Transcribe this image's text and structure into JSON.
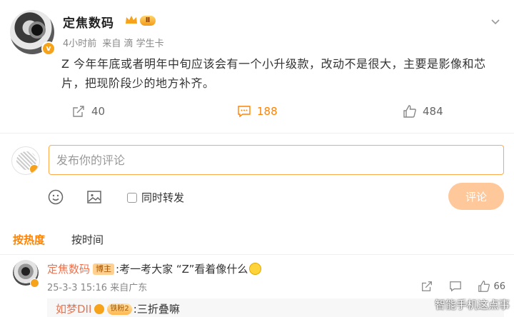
{
  "post": {
    "username": "定焦数码",
    "level": "Ⅱ",
    "time": "4小时前",
    "source_prefix": "来自",
    "source": "滴 学生卡",
    "text": "Z 今年年底或者明年中旬应该会有一个小升级款，改动不是很大，主要是影像和芯片，把现阶段少的地方补齐。",
    "reposts": "40",
    "comments": "188",
    "likes": "484"
  },
  "composer": {
    "placeholder": "发布你的评论",
    "repost_label": "同时转发",
    "submit_label": "评论"
  },
  "sort": {
    "hot_label": "按热度",
    "time_label": "按时间"
  },
  "comment": {
    "username": "定焦数码",
    "author_tag": "博主",
    "text": ":考一考大家 “Z”看着像什么",
    "date": "25-3-3 15:16",
    "location": "来自广东",
    "likes": "66"
  },
  "reply": {
    "username": "如梦DII",
    "fan_badge": "铁粉2",
    "text": ":三折叠嘛"
  },
  "watermark": "智能手机这点事",
  "colors": {
    "accent": "#ff8200",
    "username_link": "#eb7350",
    "submit_disabled": "#ffc89b"
  }
}
